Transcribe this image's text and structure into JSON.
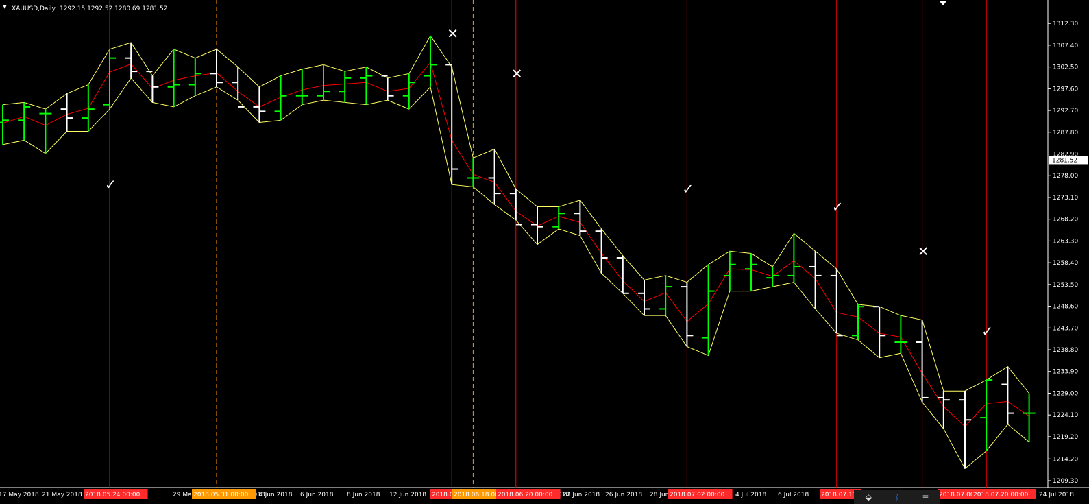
{
  "chart_info": {
    "symbol_label": "XAUUSD,Daily",
    "ohlc": "1292.15 1292.52 1280.69 1281.52",
    "current_price_label": "1281.52",
    "current_price": 1281.52
  },
  "colors": {
    "background": "#000000",
    "bull_bar": "#00ff00",
    "bear_bar": "#ffffff",
    "envelope": "#ffff66",
    "median_line": "#ff0000",
    "event_line": "#ff0000",
    "dashed_line": "#ff9900",
    "price_line": "#ffffff"
  },
  "chart_data": {
    "type": "ohlc",
    "ylim": [
      1209.3,
      1314.8
    ],
    "y_ticks": [
      "1312.30",
      "1307.40",
      "1302.50",
      "1297.60",
      "1292.70",
      "1287.80",
      "1282.90",
      "1278.00",
      "1273.10",
      "1268.20",
      "1263.30",
      "1258.40",
      "1253.50",
      "1248.60",
      "1243.70",
      "1238.80",
      "1233.90",
      "1229.00",
      "1224.10",
      "1219.20",
      "1214.20",
      "1209.30"
    ],
    "x_labels": [
      "17 May 2018",
      "21 May 2018",
      "23 May 2018",
      "29 May 2018",
      "31 May 2018",
      "4 Jun 2018",
      "6 Jun 2018",
      "8 Jun 2018",
      "12 Jun 2018",
      "14 Jun 2018",
      "20 Jun 2018",
      "22 Jun 2018",
      "26 Jun 2018",
      "28 Jun 2018",
      "4 Jul 2018",
      "6 Jul 2018",
      "10 Jul 2018",
      "18 Jul 2018",
      "24 Jul 2018"
    ],
    "event_labels": [
      "2018.05.24 00:00",
      "2018.05.31 00:00",
      "2018.0",
      "2018.06.18 00:00",
      "2018.06.20 00:00",
      "2018.07.02 00:00",
      "2018.07.11",
      "2018.07.00:00",
      "2018.07.20 00:00"
    ],
    "markers": [
      {
        "symbol": "✓",
        "price": 1276.0,
        "bar": 5
      },
      {
        "symbol": "✓",
        "price": 1275.0,
        "bar": 32
      },
      {
        "symbol": "✓",
        "price": 1271.0,
        "bar": 39
      },
      {
        "symbol": "✓",
        "price": 1243.0,
        "bar": 46
      },
      {
        "symbol": "✕",
        "price": 1310.0,
        "bar": 21
      },
      {
        "symbol": "✕",
        "price": 1301.0,
        "bar": 24
      },
      {
        "symbol": "✕",
        "price": 1261.0,
        "bar": 43
      }
    ],
    "bars": [
      [
        1290.0,
        1294.0,
        1285.0,
        1290.5
      ],
      [
        1290.5,
        1294.5,
        1286.0,
        1293.5
      ],
      [
        1292.0,
        1293.0,
        1283.0,
        1292.0
      ],
      [
        1293.0,
        1296.5,
        1288.0,
        1291.0
      ],
      [
        1291.0,
        1298.5,
        1288.0,
        1293.0
      ],
      [
        1294.0,
        1306.5,
        1293.0,
        1304.5
      ],
      [
        1304.5,
        1308.0,
        1300.0,
        1301.5
      ],
      [
        1301.5,
        1300.5,
        1294.5,
        1298.0
      ],
      [
        1298.0,
        1306.5,
        1293.5,
        1298.5
      ],
      [
        1298.5,
        1304.5,
        1296.0,
        1301.0
      ],
      [
        1301.0,
        1306.5,
        1298.0,
        1299.0
      ],
      [
        1299.0,
        1302.5,
        1295.0,
        1293.5
      ],
      [
        1293.5,
        1298.0,
        1290.0,
        1292.5
      ],
      [
        1292.5,
        1300.5,
        1290.5,
        1296.0
      ],
      [
        1296.0,
        1302.0,
        1294.0,
        1296.0
      ],
      [
        1296.0,
        1303.0,
        1295.0,
        1297.0
      ],
      [
        1297.0,
        1301.5,
        1294.5,
        1300.0
      ],
      [
        1300.0,
        1302.5,
        1294.0,
        1300.5
      ],
      [
        1300.5,
        1300.0,
        1295.0,
        1296.0
      ],
      [
        1296.0,
        1301.0,
        1293.0,
        1299.0
      ],
      [
        1300.5,
        1309.5,
        1298.0,
        1303.0
      ],
      [
        1303.0,
        1302.5,
        1276.0,
        1279.5
      ],
      [
        1277.5,
        1282.0,
        1275.5,
        1277.5
      ],
      [
        1277.5,
        1284.0,
        1271.5,
        1274.0
      ],
      [
        1274.0,
        1275.0,
        1268.0,
        1267.0
      ],
      [
        1267.0,
        1271.0,
        1262.5,
        1266.5
      ],
      [
        1266.5,
        1271.0,
        1266.0,
        1269.5
      ],
      [
        1269.5,
        1272.5,
        1264.5,
        1265.5
      ],
      [
        1265.5,
        1266.0,
        1256.0,
        1259.5
      ],
      [
        1259.5,
        1260.0,
        1251.5,
        1251.5
      ],
      [
        1251.5,
        1254.5,
        1246.5,
        1248.0
      ],
      [
        1248.0,
        1255.5,
        1246.5,
        1253.0
      ],
      [
        1253.0,
        1254.0,
        1239.5,
        1242.0
      ],
      [
        1241.5,
        1258.0,
        1237.5,
        1252.0
      ],
      [
        1255.5,
        1261.0,
        1252.0,
        1258.0
      ],
      [
        1257.0,
        1260.5,
        1252.0,
        1258.0
      ],
      [
        1255.0,
        1257.5,
        1253.0,
        1255.5
      ],
      [
        1255.5,
        1265.0,
        1254.0,
        1257.5
      ],
      [
        1257.5,
        1261.0,
        1248.0,
        1255.5
      ],
      [
        1255.5,
        1257.0,
        1242.5,
        1242.0
      ],
      [
        1242.0,
        1249.0,
        1241.0,
        1248.5
      ],
      [
        1248.5,
        1248.5,
        1237.0,
        1242.0
      ],
      [
        1240.5,
        1246.5,
        1238.0,
        1240.5
      ],
      [
        1240.5,
        1245.5,
        1227.0,
        1228.0
      ],
      [
        1228.0,
        1229.5,
        1221.0,
        1227.5
      ],
      [
        1227.5,
        1229.5,
        1212.0,
        1223.0
      ],
      [
        1223.5,
        1232.0,
        1216.0,
        1232.0
      ],
      [
        1231.0,
        1235.0,
        1222.0,
        1224.5
      ],
      [
        1224.5,
        1229.0,
        1218.0,
        1224.5
      ]
    ],
    "vertical_event_bars": [
      5,
      21,
      24,
      32,
      39,
      43,
      46
    ],
    "dashed_event_bars": [
      10,
      22
    ]
  },
  "tray": {
    "dropbox": "⬙",
    "bluetooth": "ᛒ",
    "tray_icon": "≡"
  }
}
